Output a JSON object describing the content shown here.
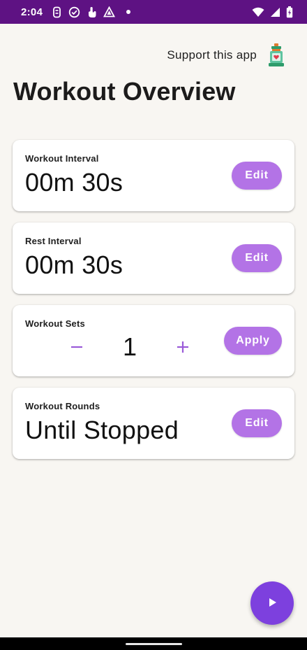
{
  "status_bar": {
    "time": "2:04",
    "left_icons": [
      "notification-icon",
      "check-circle-icon",
      "touch-icon",
      "triangle-icon"
    ],
    "right_icons": [
      "wifi-icon",
      "signal-icon",
      "battery-icon"
    ],
    "color": "#5e1283"
  },
  "header": {
    "support_text": "Support this app",
    "support_icon": "lantern-icon",
    "title": "Workout Overview"
  },
  "cards": {
    "workout_interval": {
      "label": "Workout Interval",
      "value": "00m 30s",
      "button": "Edit"
    },
    "rest_interval": {
      "label": "Rest Interval",
      "value": "00m 30s",
      "button": "Edit"
    },
    "workout_sets": {
      "label": "Workout Sets",
      "value": "1",
      "button": "Apply",
      "decrement_icon": "minus-icon",
      "increment_icon": "plus-icon"
    },
    "workout_rounds": {
      "label": "Workout Rounds",
      "value": "Until Stopped",
      "button": "Edit"
    }
  },
  "fab": {
    "icon": "play-icon"
  },
  "colors": {
    "accent": "#b373e6",
    "fab": "#7d40de",
    "background": "#f8f6f2"
  }
}
